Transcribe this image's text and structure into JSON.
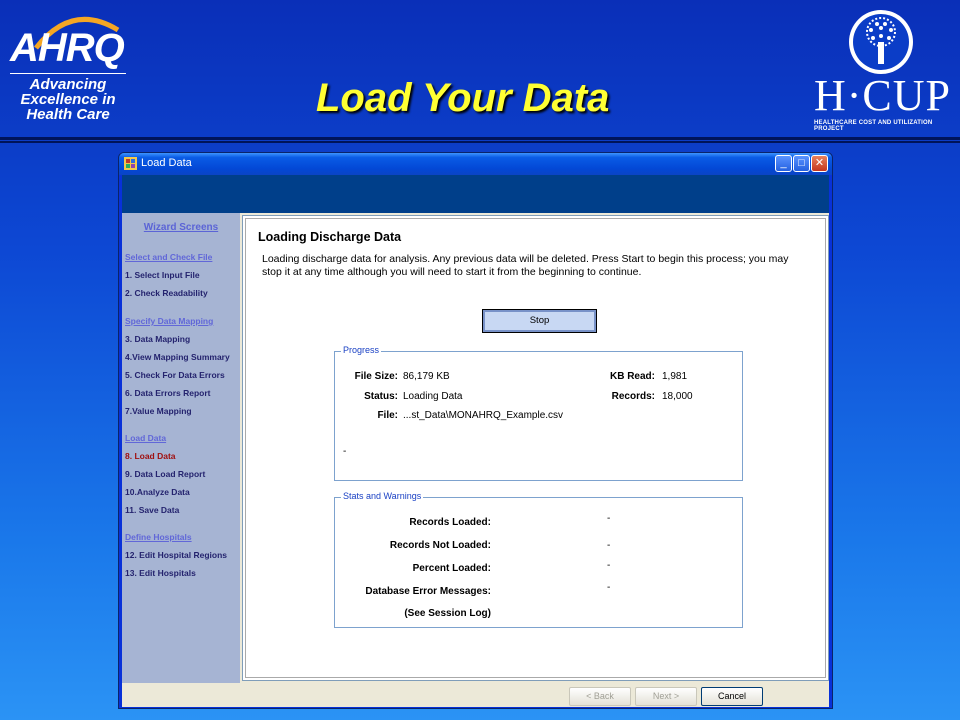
{
  "slide": {
    "ahrq_logo": "AHRQ",
    "ahrq_tagline": [
      "Advancing",
      "Excellence in",
      "Health Care"
    ],
    "title": "Load Your Data",
    "hcup_logo": "H·CUP",
    "hcup_subtitle": "HEALTHCARE COST AND UTILIZATION PROJECT"
  },
  "window": {
    "title": "Load Data",
    "buttons": {
      "minimize": "_",
      "maximize": "□",
      "close": "✕"
    }
  },
  "sidebar": {
    "header": "Wizard Screens",
    "sections": [
      {
        "title": "Select and Check File",
        "items": [
          "1. Select Input File",
          "2. Check Readability"
        ]
      },
      {
        "title": "Specify Data Mapping",
        "items": [
          "3. Data Mapping",
          "4.View Mapping Summary",
          "5. Check For Data Errors",
          "6. Data Errors Report",
          "7.Value Mapping"
        ]
      },
      {
        "title": "Load Data",
        "items": [
          "8. Load Data",
          "9. Data Load Report",
          "10.Analyze Data",
          "11. Save Data"
        ]
      },
      {
        "title": "Define Hospitals",
        "items": [
          "12. Edit Hospital Regions",
          "13. Edit Hospitals"
        ]
      }
    ],
    "active_item": "8. Load Data"
  },
  "main": {
    "heading": "Loading Discharge Data",
    "description": "Loading discharge data for analysis. Any previous data will be deleted. Press Start to begin this process; you may stop it at any time although you will need to start it from the beginning to continue.",
    "stop_label": "Stop",
    "progress": {
      "label": "Progress",
      "file_size_label": "File Size:",
      "file_size": "86,179 KB",
      "status_label": "Status:",
      "status": "Loading Data",
      "file_label": "File:",
      "file": "...st_Data\\MONAHRQ_Example.csv",
      "kb_read_label": "KB Read:",
      "kb_read": "1,981",
      "records_label": "Records:",
      "records": "18,000",
      "message": "-"
    },
    "stats": {
      "label": "Stats and Warnings",
      "rows": [
        {
          "label": "Records Loaded:",
          "value": "-"
        },
        {
          "label": "Records Not Loaded:",
          "value": "-"
        },
        {
          "label": "Percent Loaded:",
          "value": "-"
        },
        {
          "label": "Database Error Messages:",
          "value": "-"
        },
        {
          "label": "(See Session Log)",
          "value": ""
        }
      ]
    }
  },
  "footer": {
    "back": "< Back",
    "next": "Next >",
    "cancel": "Cancel"
  },
  "colors": {
    "slide_title": "#ffff33",
    "banner": "#003f8a",
    "active_step": "#a01010"
  }
}
